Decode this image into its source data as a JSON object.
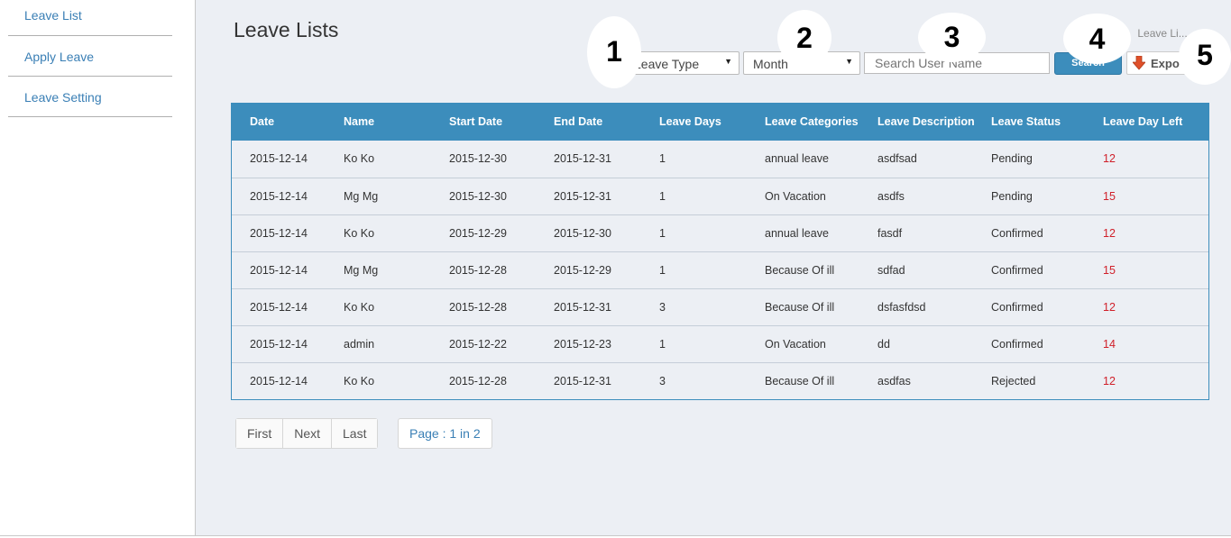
{
  "sidebar": {
    "items": [
      {
        "label": "Leave List"
      },
      {
        "label": "Apply Leave"
      },
      {
        "label": "Leave Setting"
      }
    ]
  },
  "header": {
    "title": "Leave Lists",
    "breadcrumb": [
      "›",
      "Leave Li..."
    ]
  },
  "filters": {
    "leave_type": "Leave Type",
    "month": "Month",
    "search_placeholder": "Search User Name",
    "search_label": "Search",
    "export_label": "Expo"
  },
  "callouts": [
    "1",
    "2",
    "3",
    "4",
    "5"
  ],
  "table": {
    "columns": [
      "Date",
      "Name",
      "Start Date",
      "End Date",
      "Leave Days",
      "Leave Categories",
      "Leave Description",
      "Leave Status",
      "Leave Day Left"
    ],
    "rows": [
      [
        "2015-12-14",
        "Ko Ko",
        "2015-12-30",
        "2015-12-31",
        "1",
        "annual leave",
        "asdfsad",
        "Pending",
        "12"
      ],
      [
        "2015-12-14",
        "Mg Mg",
        "2015-12-30",
        "2015-12-31",
        "1",
        "On Vacation",
        "asdfs",
        "Pending",
        "15"
      ],
      [
        "2015-12-14",
        "Ko Ko",
        "2015-12-29",
        "2015-12-30",
        "1",
        "annual leave",
        "fasdf",
        "Confirmed",
        "12"
      ],
      [
        "2015-12-14",
        "Mg Mg",
        "2015-12-28",
        "2015-12-29",
        "1",
        "Because Of ill",
        "sdfad",
        "Confirmed",
        "15"
      ],
      [
        "2015-12-14",
        "Ko Ko",
        "2015-12-28",
        "2015-12-31",
        "3",
        "Because Of ill",
        "dsfasfdsd",
        "Confirmed",
        "12"
      ],
      [
        "2015-12-14",
        "admin",
        "2015-12-22",
        "2015-12-23",
        "1",
        "On Vacation",
        "dd",
        "Confirmed",
        "14"
      ],
      [
        "2015-12-14",
        "Ko Ko",
        "2015-12-28",
        "2015-12-31",
        "3",
        "Because Of ill",
        "asdfas",
        "Rejected",
        "12"
      ]
    ]
  },
  "pagination": {
    "first": "First",
    "next": "Next",
    "last": "Last",
    "info": "Page : 1 in 2"
  },
  "colors": {
    "accent": "#3c8dbc",
    "days_left": "#d0202a",
    "link": "#3a7fb5"
  }
}
